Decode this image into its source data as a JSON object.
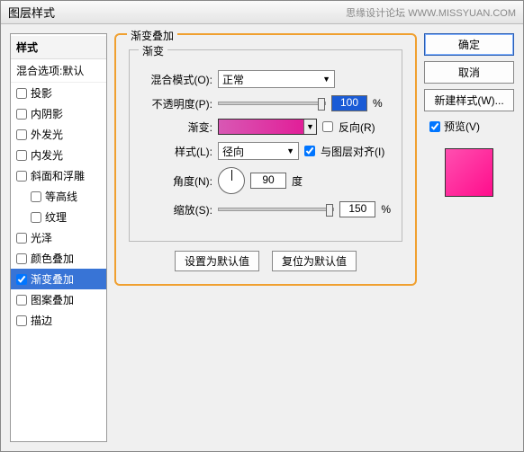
{
  "titlebar": {
    "title": "图层样式",
    "watermark": "思缘设计论坛  WWW.MISSYUAN.COM"
  },
  "sidebar": {
    "head": "样式",
    "sub": "混合选项:默认",
    "items": [
      {
        "label": "投影",
        "checked": false
      },
      {
        "label": "内阴影",
        "checked": false
      },
      {
        "label": "外发光",
        "checked": false
      },
      {
        "label": "内发光",
        "checked": false
      },
      {
        "label": "斜面和浮雕",
        "checked": false
      },
      {
        "label": "等高线",
        "checked": false,
        "indent": true
      },
      {
        "label": "纹理",
        "checked": false,
        "indent": true
      },
      {
        "label": "光泽",
        "checked": false
      },
      {
        "label": "颜色叠加",
        "checked": false
      },
      {
        "label": "渐变叠加",
        "checked": true,
        "selected": true
      },
      {
        "label": "图案叠加",
        "checked": false
      },
      {
        "label": "描边",
        "checked": false
      }
    ]
  },
  "panel": {
    "title": "渐变叠加",
    "group": "渐变",
    "blend_label": "混合模式(O):",
    "blend_value": "正常",
    "opacity_label": "不透明度(P):",
    "opacity_value": "100",
    "pct": "%",
    "gradient_label": "渐变:",
    "reverse_label": "反向(R)",
    "style_label": "样式(L):",
    "style_value": "径向",
    "align_label": "与图层对齐(I)",
    "angle_label": "角度(N):",
    "angle_value": "90",
    "angle_unit": "度",
    "scale_label": "缩放(S):",
    "scale_value": "150",
    "set_default": "设置为默认值",
    "reset_default": "复位为默认值"
  },
  "right": {
    "ok": "确定",
    "cancel": "取消",
    "new_style": "新建样式(W)...",
    "preview_label": "预览(V)"
  }
}
